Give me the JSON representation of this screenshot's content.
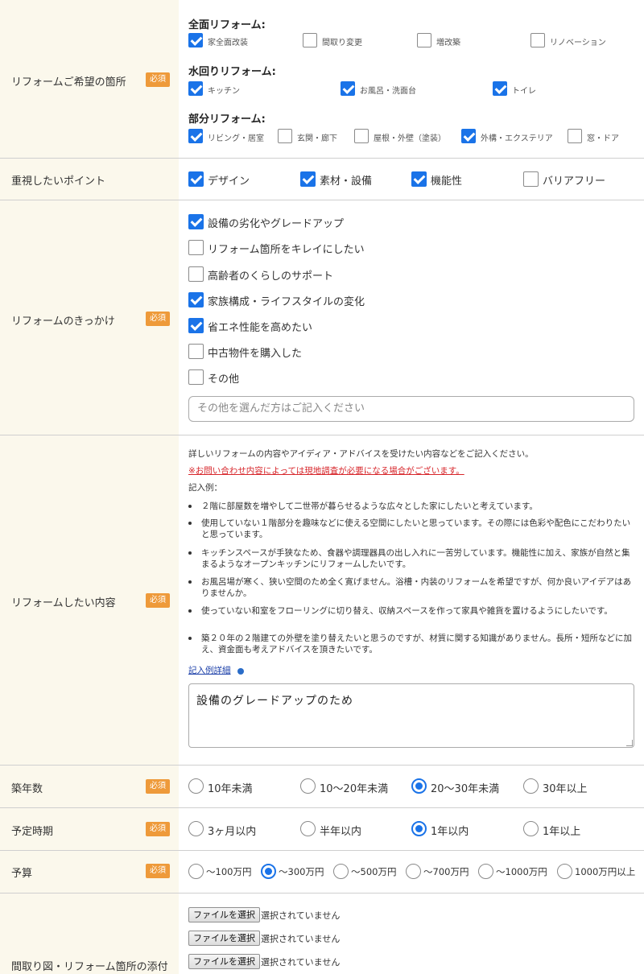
{
  "required_badge": "必須",
  "reform_location": {
    "label": "リフォームご希望の箇所",
    "full": {
      "heading": "全面リフォーム:",
      "options": [
        {
          "label": "家全面改装",
          "checked": true
        },
        {
          "label": "間取り変更",
          "checked": false
        },
        {
          "label": "増改築",
          "checked": false
        },
        {
          "label": "リノベーション",
          "checked": false
        }
      ]
    },
    "water": {
      "heading": "水回りリフォーム:",
      "options": [
        {
          "label": "キッチン",
          "checked": true
        },
        {
          "label": "お風呂・洗面台",
          "checked": true
        },
        {
          "label": "トイレ",
          "checked": true
        }
      ]
    },
    "partial": {
      "heading": "部分リフォーム:",
      "options": [
        {
          "label": "リビング・居室",
          "checked": true
        },
        {
          "label": "玄関・廊下",
          "checked": false
        },
        {
          "label": "屋根・外壁（塗装）",
          "checked": false
        },
        {
          "label": "外構・エクステリア",
          "checked": true
        },
        {
          "label": "窓・ドア",
          "checked": false
        }
      ]
    }
  },
  "priority": {
    "label": "重視したいポイント",
    "options": [
      {
        "label": "デザイン",
        "checked": true
      },
      {
        "label": "素材・設備",
        "checked": true
      },
      {
        "label": "機能性",
        "checked": true
      },
      {
        "label": "バリアフリー",
        "checked": false
      }
    ]
  },
  "trigger": {
    "label": "リフォームのきっかけ",
    "options": [
      {
        "label": "設備の劣化やグレードアップ",
        "checked": true
      },
      {
        "label": "リフォーム箇所をキレイにしたい",
        "checked": false
      },
      {
        "label": "高齢者のくらしのサポート",
        "checked": false
      },
      {
        "label": "家族構成・ライフスタイルの変化",
        "checked": true
      },
      {
        "label": "省エネ性能を高めたい",
        "checked": true
      },
      {
        "label": "中古物件を購入した",
        "checked": false
      },
      {
        "label": "その他",
        "checked": false
      }
    ],
    "other_placeholder": "その他を選んだ方はご記入ください"
  },
  "content": {
    "label": "リフォームしたい内容",
    "intro": "詳しいリフォームの内容やアイディア・アドバイスを受けたい内容などをご記入ください。",
    "warning": "※お問い合わせ内容によっては現地調査が必要になる場合がございます。",
    "example_heading": "記入例：",
    "examples": [
      "２階に部屋数を増やして二世帯が暮らせるような広々とした家にしたいと考えています。",
      "使用していない１階部分を趣味などに使える空間にしたいと思っています。その際には色彩や配色にこだわりたいと思っています。",
      "キッチンスペースが手狭なため、食器や調理器具の出し入れに一苦労しています。機能性に加え、家族が自然と集まるようなオープンキッチンにリフォームしたいです。",
      "お風呂場が寒く、狭い空間のため全く寛げません。浴槽・内装のリフォームを希望ですが、何か良いアイデアはありませんか。",
      "使っていない和室をフローリングに切り替え、収納スペースを作って家具や雑貨を置けるようにしたいです。",
      "築２０年の２階建ての外壁を塗り替えたいと思うのですが、材質に関する知識がありません。長所・短所などに加え、資金面も考えアドバイスを頂きたいです。"
    ],
    "detail_link": "記入例詳細",
    "value": "設備のグレードアップのため"
  },
  "age": {
    "label": "築年数",
    "options": [
      {
        "label": "10年未満",
        "checked": false
      },
      {
        "label": "10〜20年未満",
        "checked": false
      },
      {
        "label": "20〜30年未満",
        "checked": true
      },
      {
        "label": "30年以上",
        "checked": false
      }
    ]
  },
  "timing": {
    "label": "予定時期",
    "options": [
      {
        "label": "3ヶ月以内",
        "checked": false
      },
      {
        "label": "半年以内",
        "checked": false
      },
      {
        "label": "1年以内",
        "checked": true
      },
      {
        "label": "1年以上",
        "checked": false
      }
    ]
  },
  "budget": {
    "label": "予算",
    "options": [
      {
        "label": "〜100万円",
        "checked": false
      },
      {
        "label": "〜300万円",
        "checked": true
      },
      {
        "label": "〜500万円",
        "checked": false
      },
      {
        "label": "〜700万円",
        "checked": false
      },
      {
        "label": "〜1000万円",
        "checked": false
      },
      {
        "label": "1000万円以上",
        "checked": false
      }
    ]
  },
  "attachment": {
    "label": "間取り図・リフォーム箇所の添付",
    "button_label": "ファイルを選択",
    "status": "選択されていません"
  }
}
